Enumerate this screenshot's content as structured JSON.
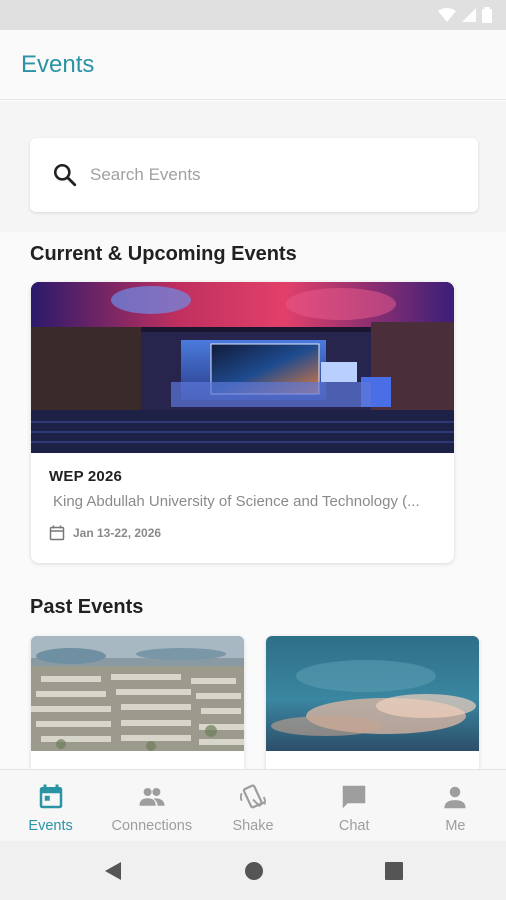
{
  "app": {
    "title": "Events",
    "accent_color": "#2a93a4"
  },
  "search": {
    "placeholder": "Search Events"
  },
  "sections": {
    "current_title": "Current & Upcoming Events",
    "past_title": "Past Events"
  },
  "current_events": [
    {
      "name": "WEP 2026",
      "location": "King Abdullah University of Science and Technology (...",
      "date": "Jan 13-22, 2026"
    }
  ],
  "past_events": [
    {
      "image": "aerial-city-photo"
    },
    {
      "image": "cloudy-sky-photo"
    }
  ],
  "bottom_nav": {
    "items": [
      {
        "label": "Events",
        "icon": "calendar-icon",
        "active": true
      },
      {
        "label": "Connections",
        "icon": "people-icon",
        "active": false
      },
      {
        "label": "Shake",
        "icon": "shake-phone-icon",
        "active": false
      },
      {
        "label": "Chat",
        "icon": "chat-icon",
        "active": false
      },
      {
        "label": "Me",
        "icon": "person-icon",
        "active": false
      }
    ]
  },
  "colors": {
    "active": "#2a93a4",
    "inactive": "#9e9e9e"
  }
}
